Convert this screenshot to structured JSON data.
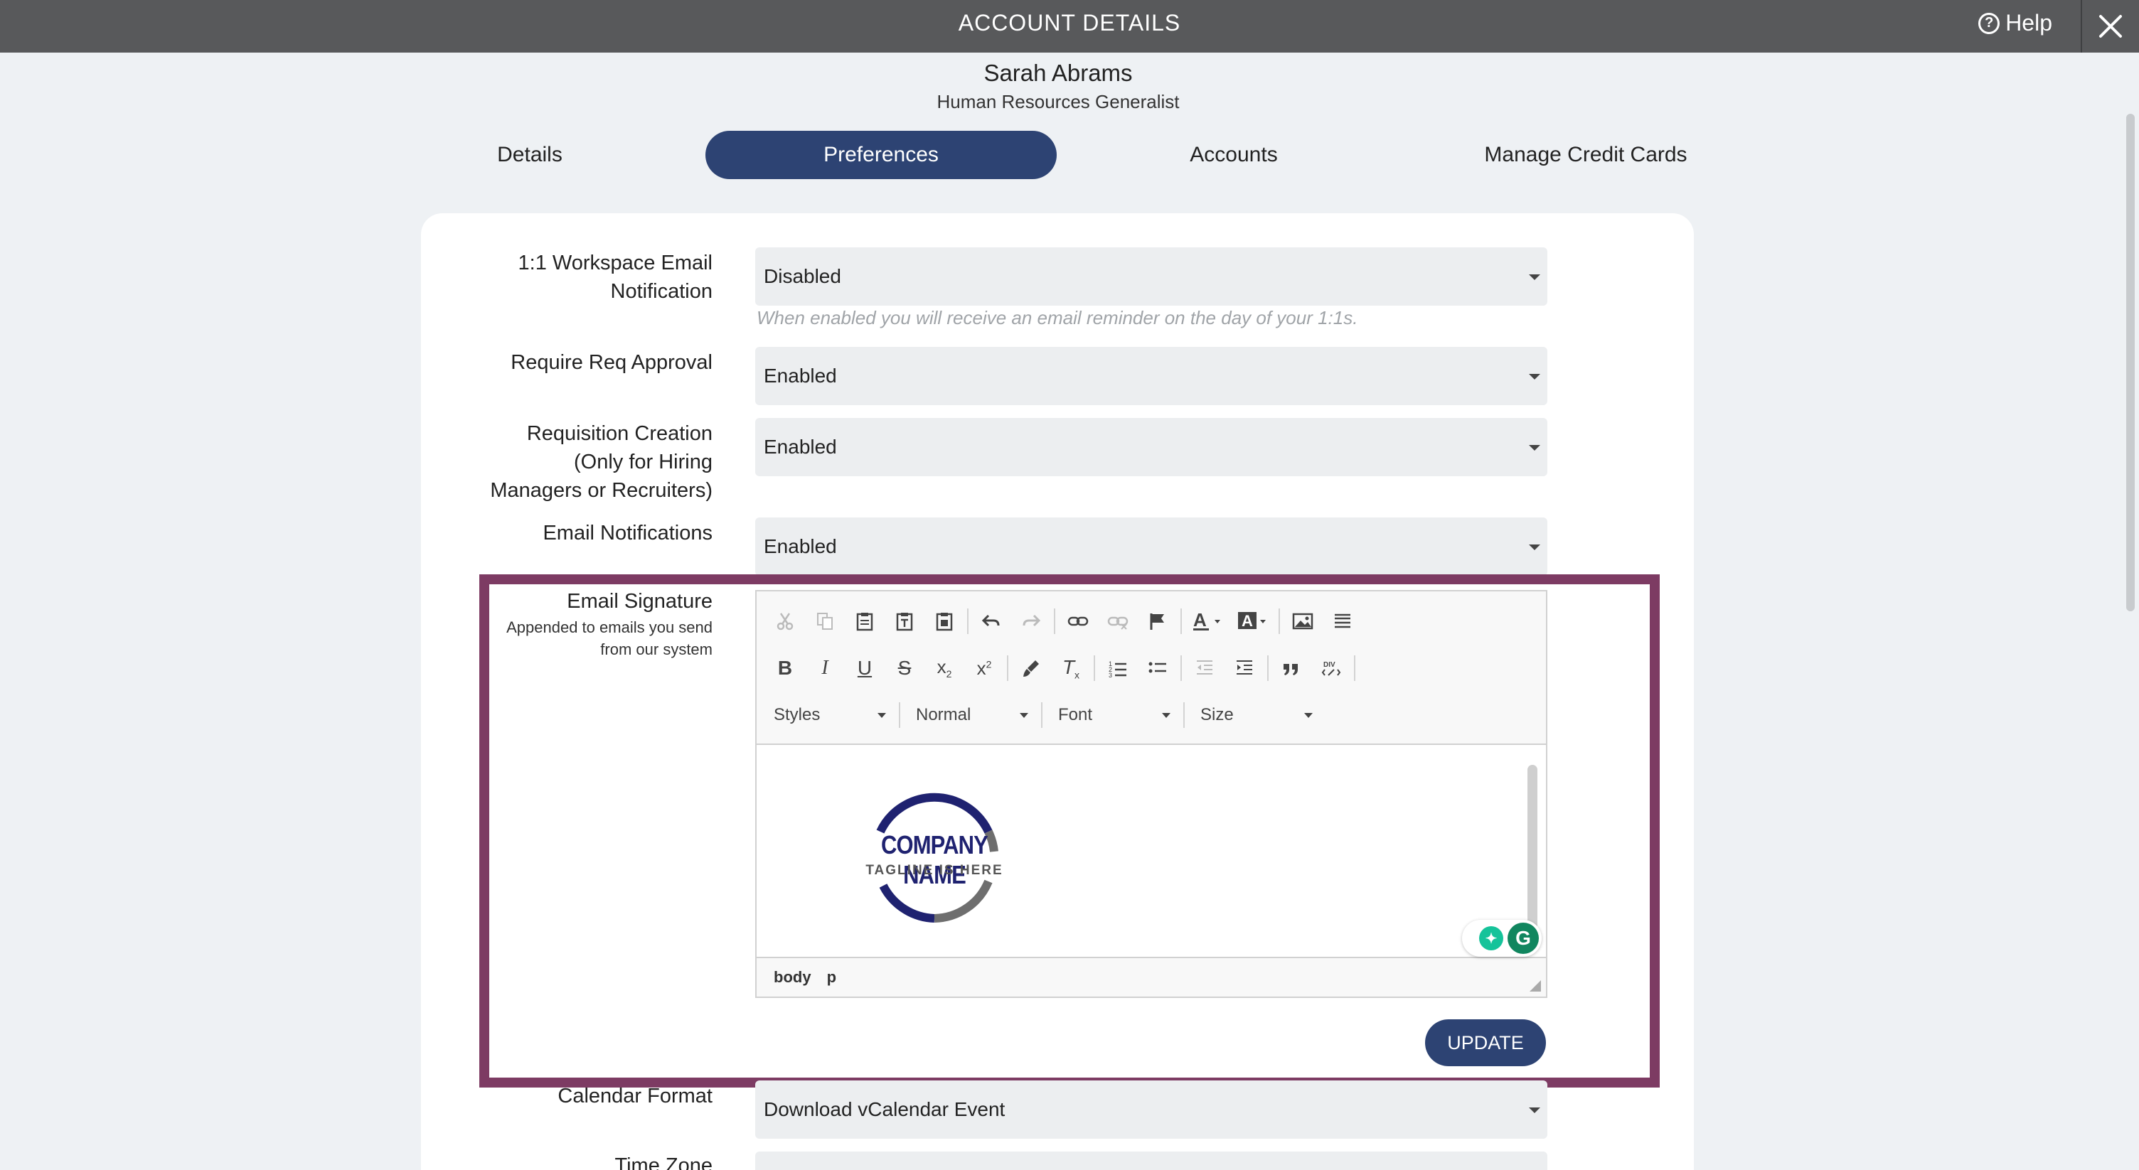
{
  "header": {
    "title": "ACCOUNT DETAILS",
    "help_label": "Help"
  },
  "profile": {
    "name": "Sarah Abrams",
    "role": "Human Resources Generalist"
  },
  "tabs": [
    {
      "label": "Details",
      "active": false
    },
    {
      "label": "Preferences",
      "active": true
    },
    {
      "label": "Accounts",
      "active": false
    },
    {
      "label": "Manage Credit Cards",
      "active": false
    }
  ],
  "settings": {
    "workspace_email": {
      "label_line1": "1:1 Workspace Email",
      "label_line2": "Notification",
      "value": "Disabled",
      "hint": "When enabled you will receive an email reminder on the day of your 1:1s."
    },
    "require_req_approval": {
      "label": "Require Req Approval",
      "value": "Enabled"
    },
    "requisition_creation": {
      "label_line1": "Requisition Creation",
      "label_line2": "(Only for Hiring",
      "label_line3": "Managers or Recruiters)",
      "value": "Enabled"
    },
    "email_notifications": {
      "label": "Email Notifications",
      "value": "Enabled"
    },
    "email_signature": {
      "label": "Email Signature",
      "sub_line1": "Appended to emails you send",
      "sub_line2": "from our system"
    },
    "calendar_format": {
      "label": "Calendar Format",
      "value": "Download vCalendar Event"
    },
    "time_zone": {
      "label": "Time Zone"
    }
  },
  "editor": {
    "combos": {
      "styles": "Styles",
      "format": "Normal",
      "font": "Font",
      "size": "Size"
    },
    "path": [
      "body",
      "p"
    ],
    "logo": {
      "company": "COMPANY NAME",
      "tagline": "TAGLINE IS HERE"
    }
  },
  "update_label": "UPDATE",
  "colors": {
    "accent": "#2d4373",
    "highlight": "#7d3b63",
    "topbar": "#58595b"
  }
}
